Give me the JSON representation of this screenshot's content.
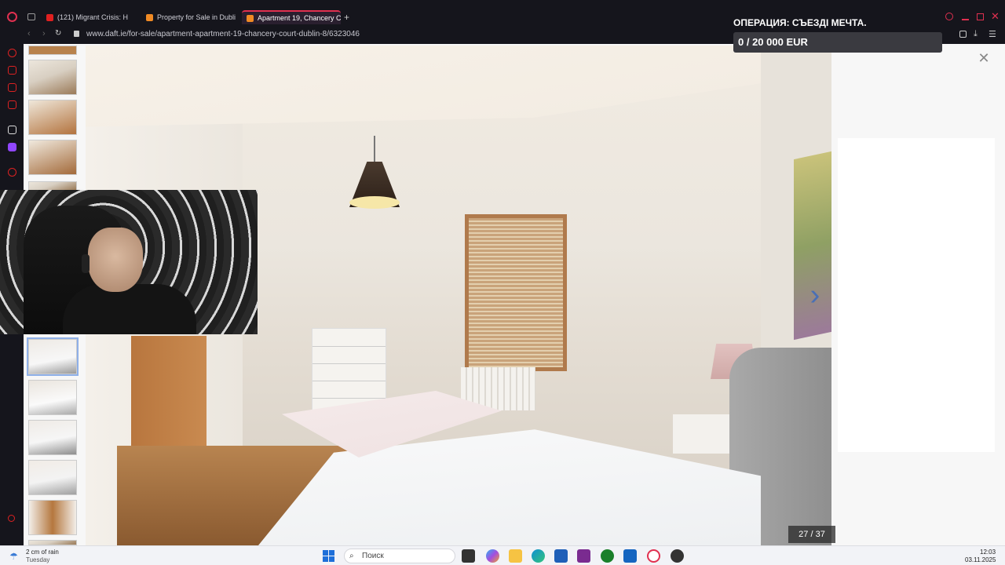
{
  "browser": {
    "tabs": [
      {
        "label": "(121) Migrant Crisis: H",
        "active": false,
        "favicon_color": "#e02020"
      },
      {
        "label": "Property for Sale in Dubli",
        "active": false,
        "favicon_color": "#f08a24"
      },
      {
        "label": "Apartment 19, Chancery C",
        "active": true,
        "favicon_color": "#f08a24"
      }
    ],
    "new_tab_label": "+",
    "url": "www.daft.ie/for-sale/apartment-apartment-19-chancery-court-dublin-8/6323046"
  },
  "overlay": {
    "goal_title": "ОПЕРАЦИЯ: СЪЕЗДІ МЕЧТА.",
    "goal_amount": "0 / 20 000 EUR",
    "goal_progress": 0
  },
  "gallery": {
    "counter": "27 / 37",
    "next_icon": "chevron-right-icon",
    "close_icon": "close-icon"
  },
  "taskbar": {
    "weather_line1": "2 cm of rain",
    "weather_line2": "Tuesday",
    "search_placeholder": "Поиск",
    "time": "12:03",
    "date": "03.11.2025"
  },
  "colors": {
    "accent": "#e03050",
    "arrow": "#4a6fb5"
  }
}
